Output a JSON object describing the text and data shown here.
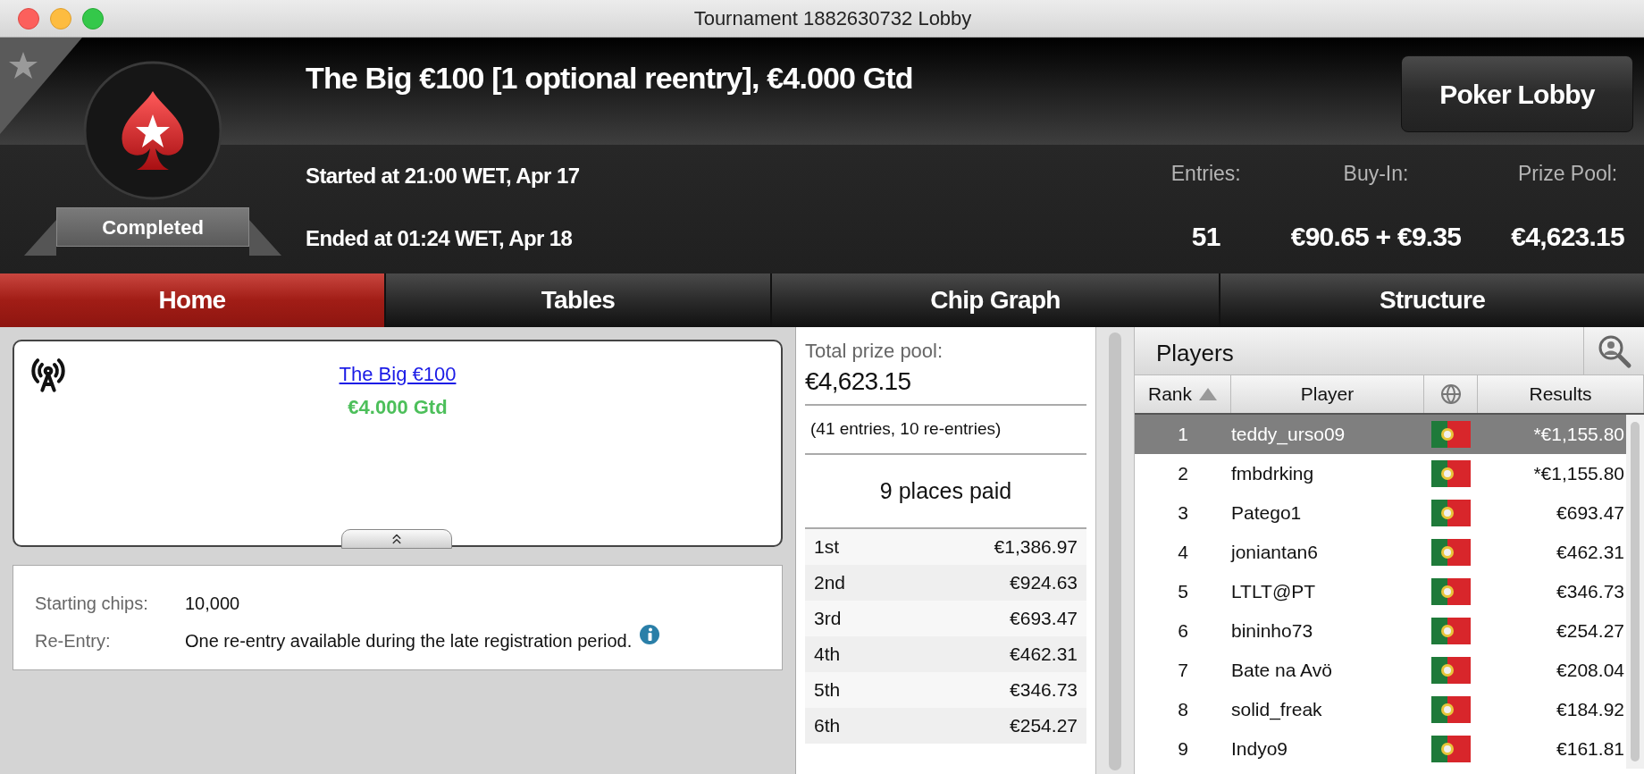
{
  "window": {
    "title": "Tournament 1882630732 Lobby"
  },
  "header": {
    "title": "The Big €100 [1 optional reentry], €4.000 Gtd",
    "status": "Completed",
    "started": "Started at 21:00 WET, Apr 17",
    "ended": "Ended at 01:24 WET, Apr 18",
    "lobby_button": "Poker Lobby"
  },
  "stats": [
    {
      "label": "Entries:",
      "value": "51"
    },
    {
      "label": "Buy-In:",
      "value": "€90.65 + €9.35"
    },
    {
      "label": "Prize Pool:",
      "value": "€4,623.15"
    }
  ],
  "tabs": [
    {
      "label": "Home",
      "selected": true
    },
    {
      "label": "Tables",
      "selected": false
    },
    {
      "label": "Chip Graph",
      "selected": false
    },
    {
      "label": "Structure",
      "selected": false
    }
  ],
  "tournament_card": {
    "link": "The Big €100",
    "guarantee": "€4.000 Gtd"
  },
  "details": [
    {
      "label": "Starting chips:",
      "value": "10,000",
      "info": false
    },
    {
      "label": "Re-Entry:",
      "value": "One re-entry available during the late registration period.",
      "info": true
    }
  ],
  "prize_pool": {
    "label": "Total prize pool:",
    "amount": "€4,623.15",
    "entries_note": "(41 entries, 10 re-entries)",
    "places_paid": "9 places paid",
    "payouts": [
      {
        "place": "1st",
        "amount": "€1,386.97"
      },
      {
        "place": "2nd",
        "amount": "€924.63"
      },
      {
        "place": "3rd",
        "amount": "€693.47"
      },
      {
        "place": "4th",
        "amount": "€462.31"
      },
      {
        "place": "5th",
        "amount": "€346.73"
      },
      {
        "place": "6th",
        "amount": "€254.27"
      }
    ]
  },
  "players": {
    "title": "Players",
    "columns": [
      {
        "kind": "text",
        "label": "Rank",
        "sorted": true
      },
      {
        "kind": "text",
        "label": "Player",
        "sorted": false
      },
      {
        "kind": "globe"
      },
      {
        "kind": "text",
        "label": "Results",
        "sorted": false
      }
    ],
    "rows": [
      {
        "rank": "1",
        "player": "teddy_urso09",
        "result": "*€1,155.80",
        "selected": true
      },
      {
        "rank": "2",
        "player": "fmbdrking",
        "result": "*€1,155.80",
        "selected": false
      },
      {
        "rank": "3",
        "player": "Patego1",
        "result": "€693.47",
        "selected": false
      },
      {
        "rank": "4",
        "player": "joniantan6",
        "result": "€462.31",
        "selected": false
      },
      {
        "rank": "5",
        "player": "LTLT@PT",
        "result": "€346.73",
        "selected": false
      },
      {
        "rank": "6",
        "player": "bininho73",
        "result": "€254.27",
        "selected": false
      },
      {
        "rank": "7",
        "player": "Bate na Avö",
        "result": "€208.04",
        "selected": false
      },
      {
        "rank": "8",
        "player": "solid_freak",
        "result": "€184.92",
        "selected": false
      },
      {
        "rank": "9",
        "player": "Indyo9",
        "result": "€161.81",
        "selected": false
      }
    ]
  }
}
